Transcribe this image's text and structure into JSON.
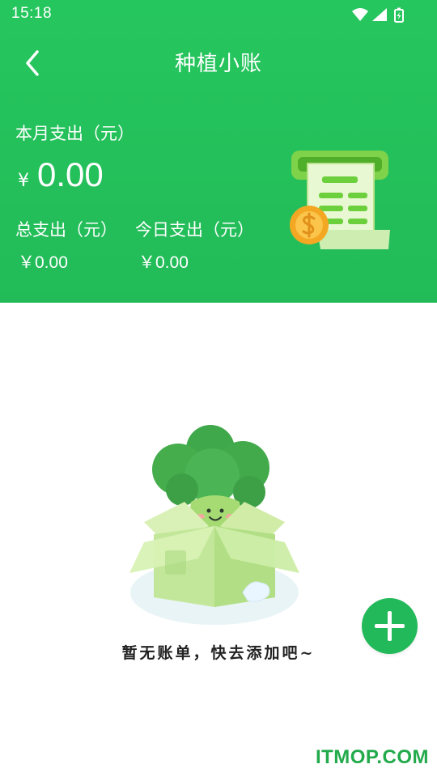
{
  "status_bar": {
    "time": "15:18",
    "icons": [
      "wifi-icon",
      "signal-icon",
      "battery-icon"
    ]
  },
  "nav": {
    "title": "种植小账",
    "back_icon": "chevron-left-icon"
  },
  "summary": {
    "month_label": "本月支出（元）",
    "currency": "¥",
    "month_amount": "0.00",
    "total_label": "总支出（元）",
    "total_amount": "￥0.00",
    "today_label": "今日支出（元）",
    "today_amount": "￥0.00"
  },
  "empty_state": {
    "message": "暂无账单，快去添加吧~",
    "illustration": "broccoli-in-box-illustration"
  },
  "fab": {
    "icon": "plus-icon"
  },
  "watermark": {
    "text": "ITMOP.COM"
  },
  "colors": {
    "primary": "#22bb58",
    "fab": "#22b95a",
    "text_dark": "#222222",
    "white": "#ffffff"
  }
}
